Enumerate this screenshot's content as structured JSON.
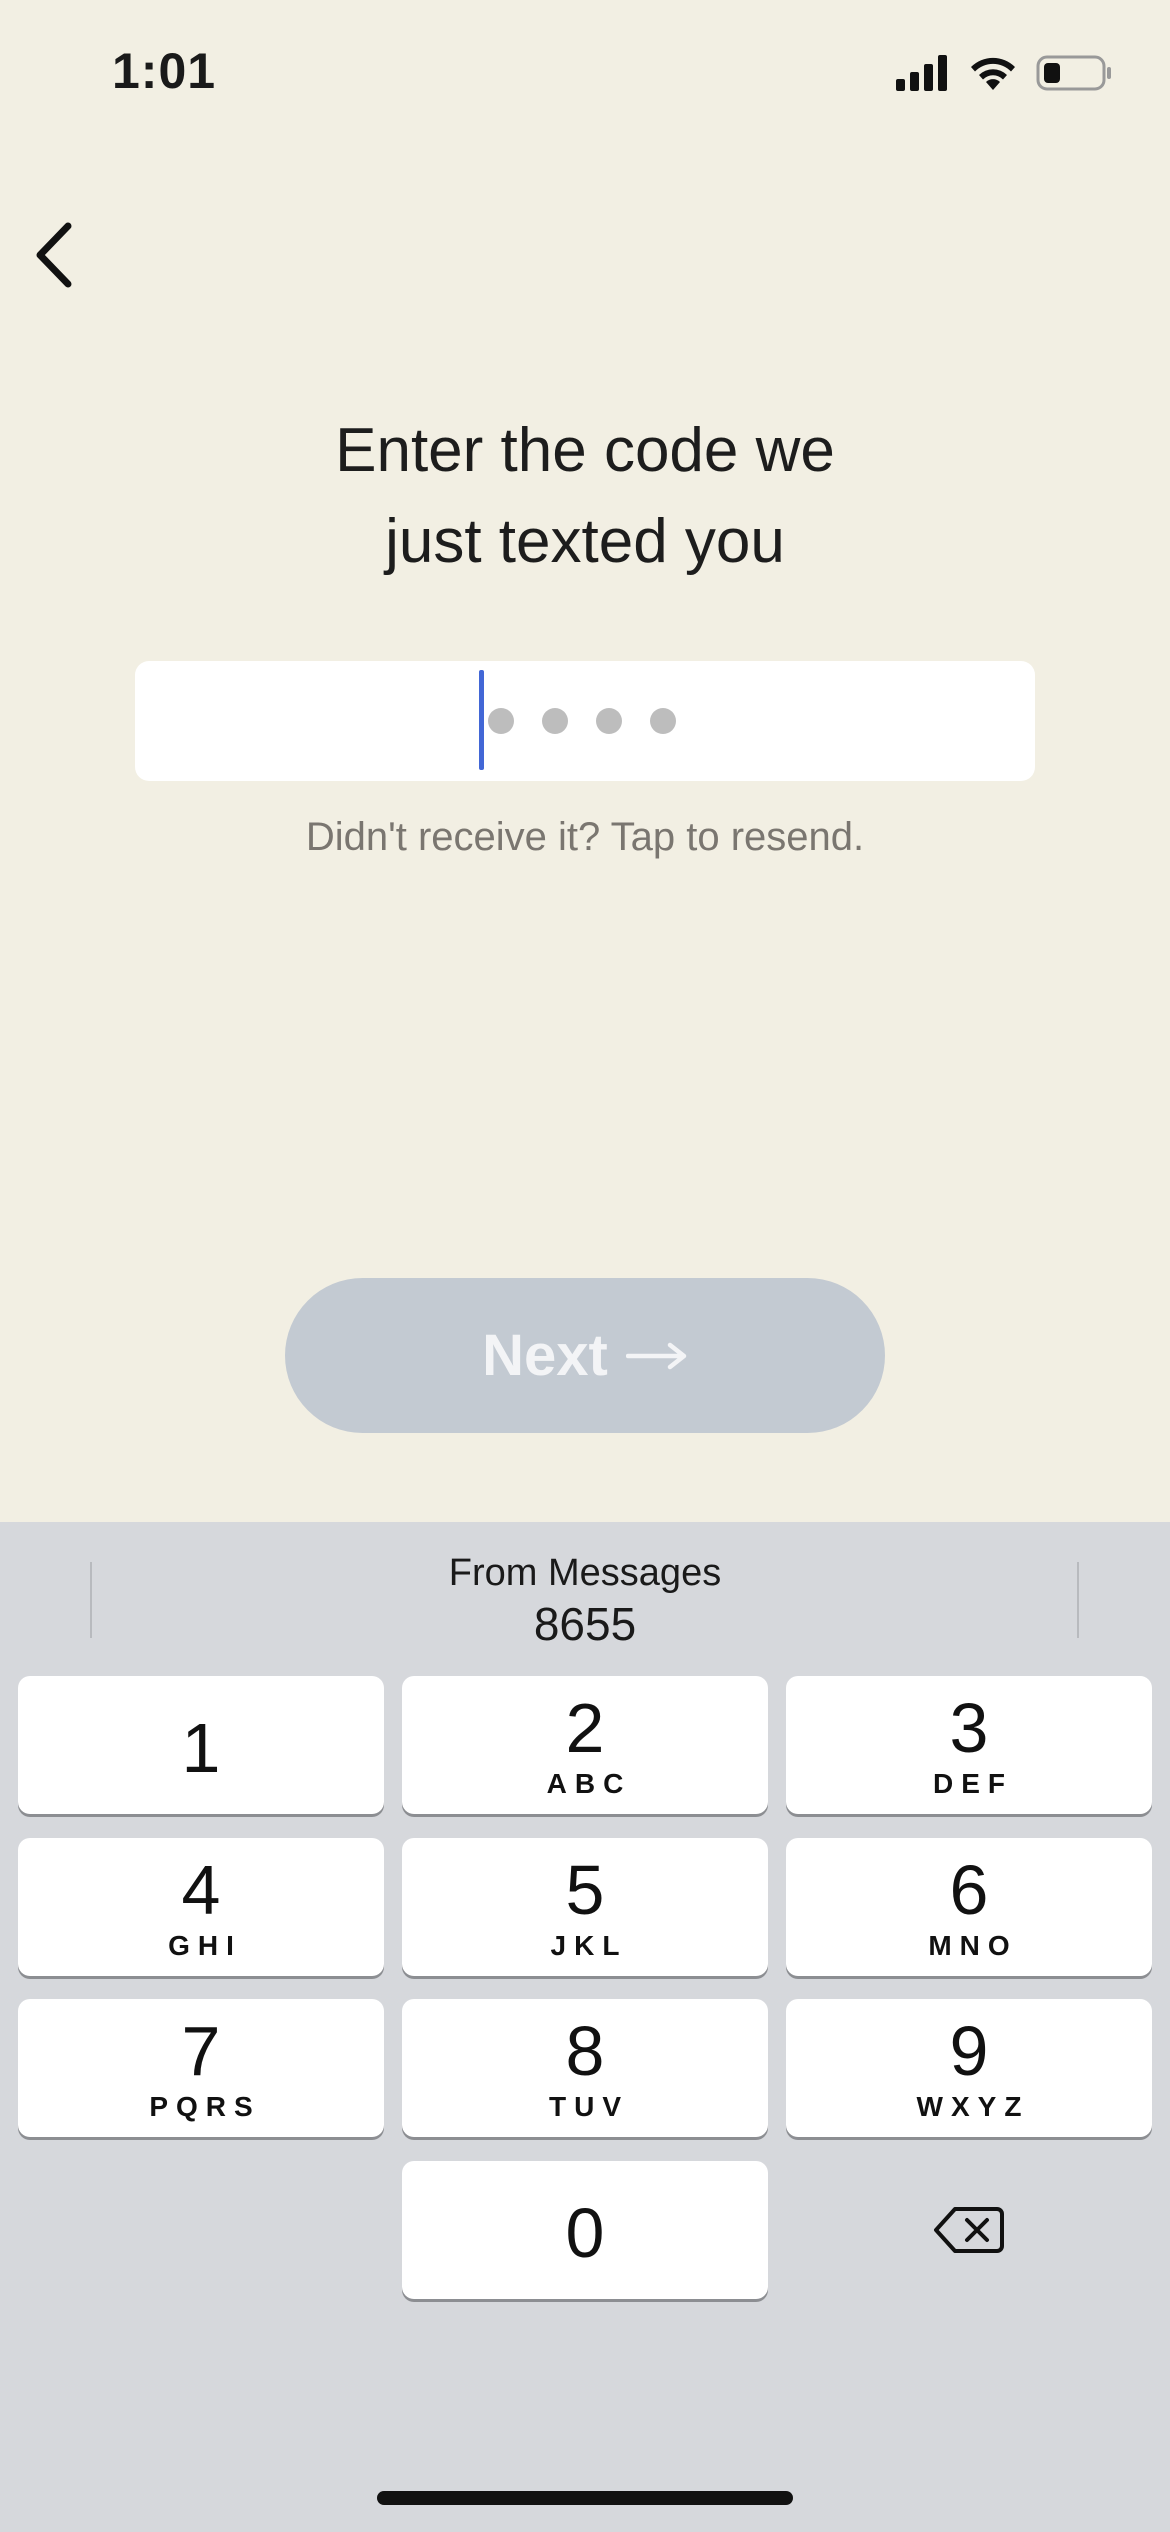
{
  "status_bar": {
    "time": "1:01",
    "icons": [
      "cellular-signal-icon",
      "wifi-icon",
      "battery-icon"
    ]
  },
  "header": {
    "back_icon": "chevron-left-icon"
  },
  "main": {
    "title_line1": "Enter the code we",
    "title_line2": "just texted you",
    "code_field": {
      "value": "",
      "placeholder_dots": 4
    },
    "resend_text": "Didn't receive it? Tap to resend.",
    "next_label": "Next",
    "next_icon": "arrow-right-icon",
    "next_enabled": false
  },
  "keyboard": {
    "suggestion": {
      "source": "From Messages",
      "code": "8655"
    },
    "keys": [
      {
        "digit": "1",
        "letters": ""
      },
      {
        "digit": "2",
        "letters": "ABC"
      },
      {
        "digit": "3",
        "letters": "DEF"
      },
      {
        "digit": "4",
        "letters": "GHI"
      },
      {
        "digit": "5",
        "letters": "JKL"
      },
      {
        "digit": "6",
        "letters": "MNO"
      },
      {
        "digit": "7",
        "letters": "PQRS"
      },
      {
        "digit": "8",
        "letters": "TUV"
      },
      {
        "digit": "9",
        "letters": "WXYZ"
      },
      {
        "digit": "0",
        "letters": ""
      }
    ],
    "delete_icon": "backspace-icon"
  },
  "colors": {
    "background": "#f2efe3",
    "caret": "#4267d6",
    "button_disabled": "#c3cad2",
    "keyboard_bg": "#d6d8dc"
  }
}
